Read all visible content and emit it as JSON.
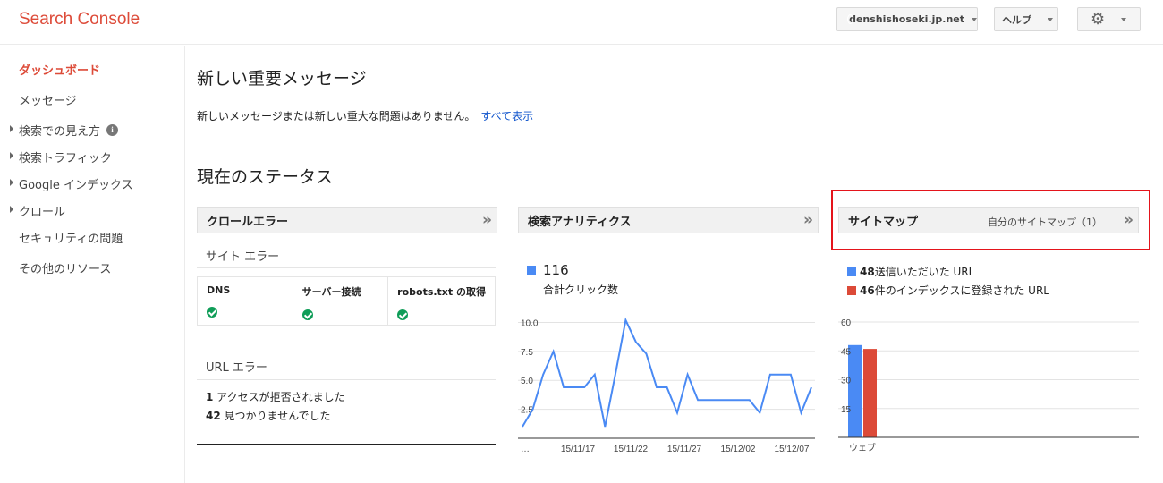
{
  "header": {
    "brand": "Search Console",
    "site_selector": "denshishoseki.jp.net",
    "help_label": "ヘルプ",
    "settings_icon": "gear-icon"
  },
  "sidebar": {
    "items": [
      {
        "label": "ダッシュボード",
        "active": true,
        "expandable": false
      },
      {
        "label": "メッセージ",
        "active": false,
        "expandable": false
      },
      {
        "label": "検索での見え方",
        "active": false,
        "expandable": true,
        "info_icon": true
      },
      {
        "label": "検索トラフィック",
        "active": false,
        "expandable": true
      },
      {
        "label": "Google インデックス",
        "active": false,
        "expandable": true
      },
      {
        "label": "クロール",
        "active": false,
        "expandable": true
      },
      {
        "label": "セキュリティの問題",
        "active": false,
        "expandable": false
      },
      {
        "label": "その他のリソース",
        "active": false,
        "expandable": false
      }
    ]
  },
  "messages": {
    "title": "新しい重要メッセージ",
    "text": "新しいメッセージまたは新しい重大な問題はありません。",
    "link": "すべて表示"
  },
  "status": {
    "title": "現在のステータス",
    "crawl_errors": {
      "header": "クロールエラー",
      "site_errors_label": "サイト エラー",
      "columns": [
        "DNS",
        "サーバー接続",
        "robots.txt の取得"
      ],
      "url_errors_label": "URL エラー",
      "url_errors": [
        {
          "count": "1",
          "text": " アクセスが拒否されました"
        },
        {
          "count": "42",
          "text": " 見つかりませんでした"
        }
      ]
    },
    "search_analytics": {
      "header": "検索アナリティクス",
      "total": "116",
      "total_label": "合計クリック数",
      "color": "#4a8af4"
    },
    "sitemaps": {
      "header": "サイトマップ",
      "my_sitemaps": "自分のサイトマップ（1）",
      "submitted": {
        "count": "48",
        "label": " 送信いただいた URL",
        "color": "#4a8af4"
      },
      "indexed": {
        "count": "46",
        "label": " 件のインデックスに登録された URL",
        "color": "#dc4a38"
      }
    }
  },
  "chart_data": [
    {
      "type": "line",
      "series": [
        {
          "values": [
            1.0,
            2.5,
            5.5,
            7.5,
            4.4,
            4.4,
            4.4,
            5.5,
            1.0,
            5.5,
            10.2,
            8.3,
            7.3,
            4.4,
            4.4,
            2.2,
            5.5,
            3.3,
            3.3,
            3.3,
            3.3,
            3.3,
            3.3,
            2.2,
            5.5,
            5.5,
            5.5,
            2.2,
            4.4
          ]
        }
      ],
      "x_tick_labels": [
        "…",
        "15/11/17",
        "15/11/22",
        "15/11/27",
        "15/12/02",
        "15/12/07"
      ],
      "y_ticks": [
        2.5,
        5.0,
        7.5,
        10.0
      ],
      "y_tick_labels": [
        "2.5",
        "5.0",
        "7.5",
        "10.0"
      ],
      "ylim": [
        0,
        10.5
      ],
      "grid": true
    },
    {
      "type": "bar",
      "categories": [
        "ウェブ"
      ],
      "series": [
        {
          "name": "送信いただいた URL",
          "values": [
            48
          ]
        },
        {
          "name": "インデックスに登録された URL",
          "values": [
            46
          ]
        }
      ],
      "y_ticks": [
        15,
        30,
        45,
        60
      ],
      "ylim": [
        0,
        60
      ],
      "grid": true
    }
  ]
}
